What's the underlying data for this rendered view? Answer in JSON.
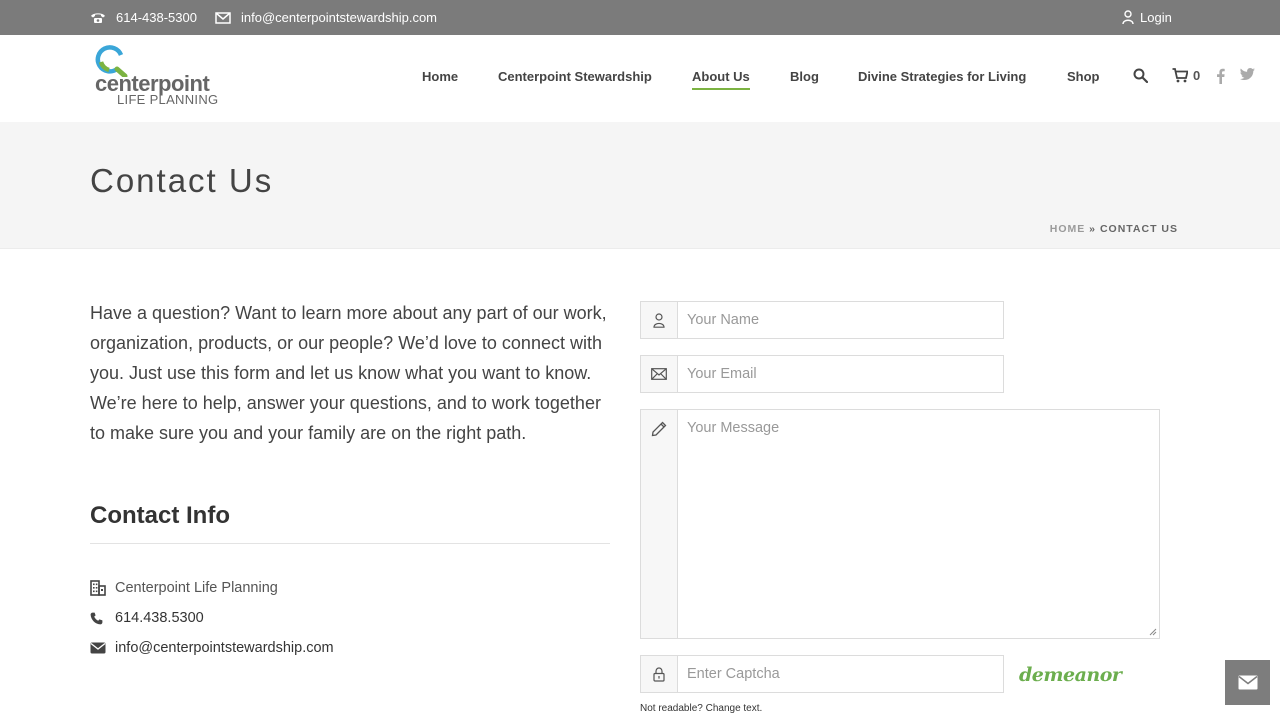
{
  "topbar": {
    "phone": "614-438-5300",
    "email": "info@centerpointstewardship.com",
    "login_label": "Login",
    "icons": [
      "phone-icon",
      "mail-icon",
      "user-icon"
    ]
  },
  "header": {
    "logo_line1": "centerpoint",
    "logo_line2": "LIFE PLANNING",
    "nav": [
      {
        "label": "Home"
      },
      {
        "label": "Centerpoint Stewardship"
      },
      {
        "label": "About Us",
        "active": true
      },
      {
        "label": "Blog"
      },
      {
        "label": "Divine Strategies for Living"
      },
      {
        "label": "Shop"
      }
    ],
    "cart_count": "0",
    "icons": [
      "search-icon",
      "cart-icon",
      "facebook-icon",
      "twitter-icon"
    ]
  },
  "title_band": {
    "title": "Contact Us",
    "breadcrumb_home": "HOME",
    "breadcrumb_sep": "»",
    "breadcrumb_current": "CONTACT US"
  },
  "content": {
    "intro": "Have a question? Want to learn more about any part of our work, organization, products, or our people? We’d love to connect with you. Just use this form and let us know what you want to know. We’re here to help, answer your questions, and to work together to make sure you and your family are on the right path.",
    "contact_title": "Contact Info",
    "contact_items": [
      {
        "icon": "building-icon",
        "text": "Centerpoint Life Planning"
      },
      {
        "icon": "phone-icon",
        "text": "614.438.5300"
      },
      {
        "icon": "envelope-icon",
        "text": "info@centerpointstewardship.com"
      }
    ]
  },
  "form": {
    "name_placeholder": "Your Name",
    "email_placeholder": "Your Email",
    "message_placeholder": "Your Message",
    "captcha_placeholder": "Enter Captcha",
    "captcha_text": "demeanor",
    "captcha_help": "Not readable? Change text."
  },
  "colors": {
    "topbar_bg": "#7b7b7b",
    "accent_green": "#7cb342",
    "title_band_bg": "#f5f5f5",
    "fab_bg": "#7d7d7d"
  }
}
